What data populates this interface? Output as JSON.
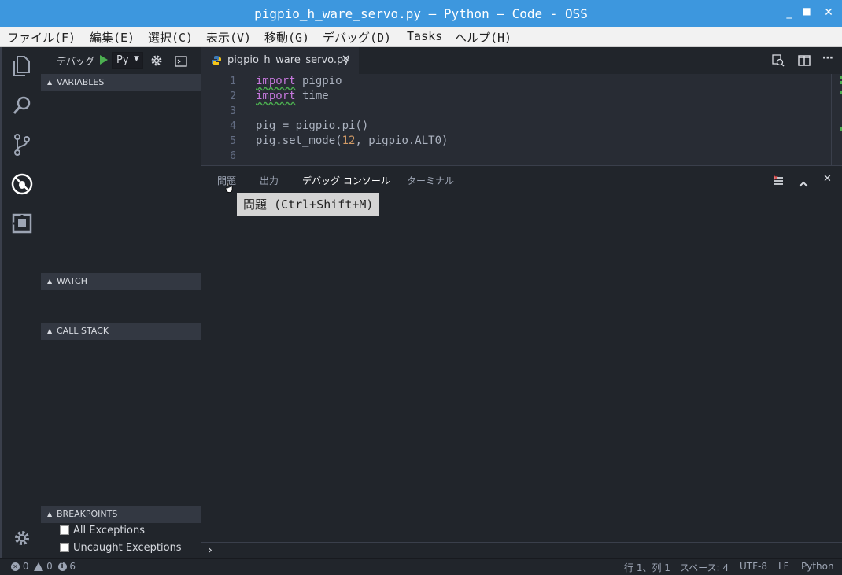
{
  "window": {
    "title": "pigpio_h_ware_servo.py — Python — Code - OSS"
  },
  "menu": [
    "ファイル(F)",
    "編集(E)",
    "選択(C)",
    "表示(V)",
    "移動(G)",
    "デバッグ(D)",
    "Tasks",
    "ヘルプ(H)"
  ],
  "activity_bar": {
    "icons": [
      "explorer-icon",
      "search-icon",
      "source-control-icon",
      "debug-icon",
      "extensions-icon",
      "gear-icon"
    ]
  },
  "debug_toolbar": {
    "label": "デバッグ",
    "config": "Py"
  },
  "sidebar": {
    "sections": {
      "variables": "VARIABLES",
      "watch": "WATCH",
      "call_stack": "CALL STACK",
      "breakpoints": "BREAKPOINTS"
    },
    "breakpoints": [
      "All Exceptions",
      "Uncaught Exceptions"
    ]
  },
  "editor": {
    "tab_name": "pigpio_h_ware_servo.py",
    "line_numbers": [
      "1",
      "2",
      "3",
      "4",
      "5",
      "6"
    ],
    "code": {
      "l1_kw": "import",
      "l1_rest": " pigpio",
      "l2_kw": "import",
      "l2_rest": " time",
      "l4": "pig = pigpio.pi()",
      "l5_a": "pig.set_mode(",
      "l5_num": "12",
      "l5_b": ", pigpio.ALT0)"
    }
  },
  "panel": {
    "tabs": [
      "問題",
      "出力",
      "デバッグ コンソール",
      "ターミナル"
    ],
    "active_tab": "デバッグ コンソール",
    "tooltip": "問題 (Ctrl+Shift+M)",
    "prompt": "›"
  },
  "status_bar": {
    "errors": "0",
    "warnings": "0",
    "infos": "6",
    "position": "行 1、列 1",
    "spaces": "スペース: 4",
    "encoding": "UTF-8",
    "eol": "LF",
    "language": "Python"
  },
  "colors": {
    "title_bar": "#3d97de",
    "background": "#21252b",
    "editor": "#282c34",
    "keyword": "#c678dd",
    "number": "#d19a66",
    "run": "#4caf50"
  }
}
